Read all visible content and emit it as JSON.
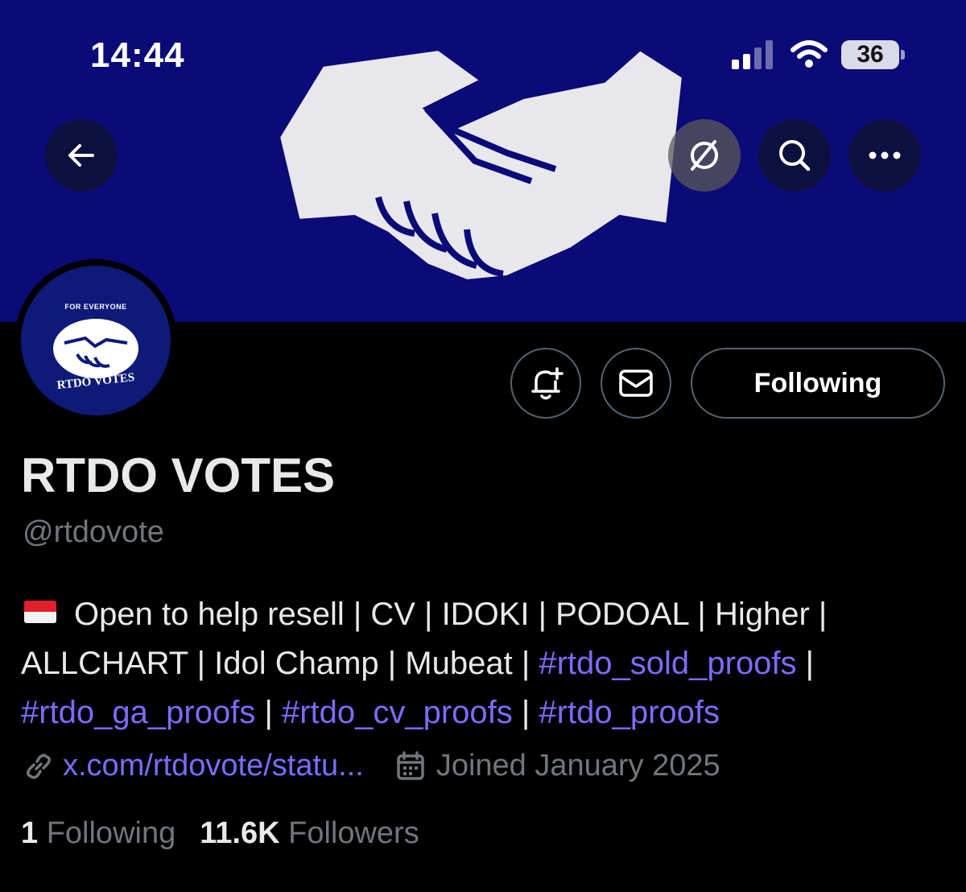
{
  "status_bar": {
    "time": "14:44",
    "battery": "36"
  },
  "header": {
    "back_icon": "arrow-left-icon",
    "grok_icon": "grok-icon",
    "search_icon": "search-icon",
    "more_icon": "more-horizontal-icon"
  },
  "avatar": {
    "top_text": "FOR EVERYONE",
    "bottom_text": "RTDO VOTES"
  },
  "actions": {
    "notify_icon": "bell-plus-icon",
    "message_icon": "mail-icon",
    "following_label": "Following"
  },
  "profile": {
    "display_name": "RTDO VOTES",
    "handle": "@rtdovote",
    "bio": {
      "flag": "indonesia-flag",
      "line1_text": "Open to help resell | CV | IDOKI | PODOAL | Higher |",
      "line2_text": "ALLCHART | Idol Champ | Mubeat | ",
      "tag1": "#rtdo_sold_proofs",
      "sep1": " |",
      "tag2": "#rtdo_ga_proofs",
      "sep2": " | ",
      "tag3": "#rtdo_cv_proofs",
      "sep3": " | ",
      "tag4": "#rtdo_proofs"
    },
    "link": "x.com/rtdovote/statu...",
    "joined": "Joined January 2025",
    "following_count": "1",
    "following_label": "Following",
    "followers_count": "11.6K",
    "followers_label": "Followers"
  },
  "colors": {
    "banner": "#0a0a78",
    "link": "#7b6cff",
    "muted": "#71767b"
  }
}
